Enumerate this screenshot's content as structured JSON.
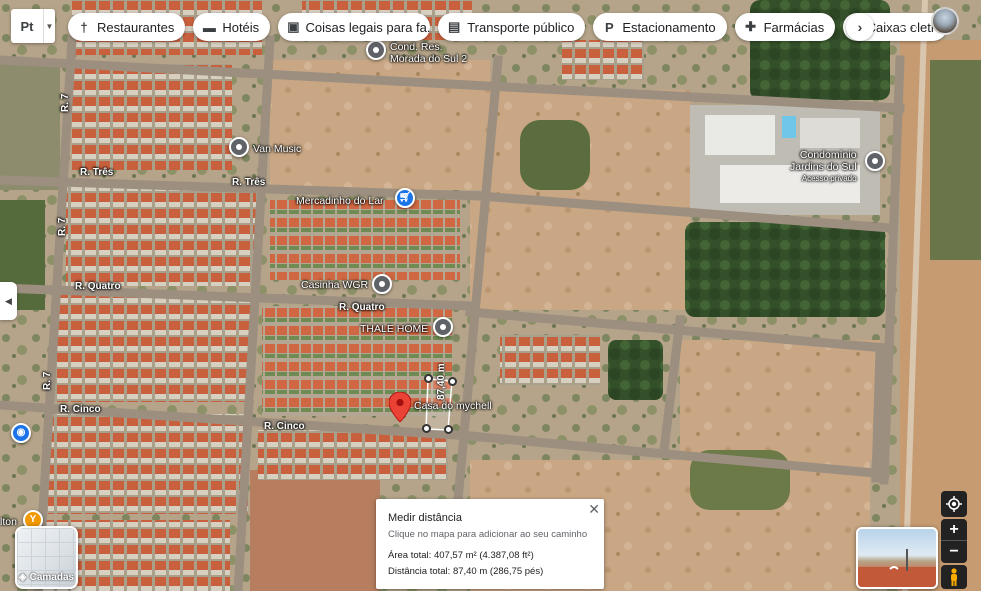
{
  "language_selector": {
    "label": "Pt"
  },
  "chips": [
    {
      "icon": "fork-knife-icon",
      "glyph": "†",
      "label": "Restaurantes"
    },
    {
      "icon": "bed-icon",
      "glyph": "▬",
      "label": "Hotéis"
    },
    {
      "icon": "camera-icon",
      "glyph": "▣",
      "label": "Coisas legais para fa..."
    },
    {
      "icon": "train-icon",
      "glyph": "▤",
      "label": "Transporte público"
    },
    {
      "icon": "parking-icon",
      "glyph": "P",
      "label": "Estacionamento"
    },
    {
      "icon": "pharmacy-icon",
      "glyph": "✚",
      "label": "Farmácias"
    },
    {
      "icon": "atm-icon",
      "glyph": "∷",
      "label": "Caixas eletrônicos"
    }
  ],
  "roads": {
    "r7_top": "R. 7",
    "r7_mid": "R. 7",
    "r7_bottom": "R. 7",
    "tres_left": "R. Três",
    "tres_right": "R. Três",
    "quatro_left": "R. Quatro",
    "quatro_right": "R. Quatro",
    "cinco_left": "R. Cinco",
    "cinco_right": "R. Cinco"
  },
  "places": {
    "cond_res_line1": "Cond. Res.",
    "cond_res_line2": "Morada do Sul 2",
    "van_music": "Van Music",
    "mercadinho": "Mercadinho do Lar",
    "casinha": "Casinha WGR",
    "thale_home": "THALE HOME",
    "casa_mychell": "Casa do mychell",
    "condominio_line1": "Condomínio",
    "condominio_line2": "Jardins do Sul",
    "acesso": "Acesso privado",
    "alton": "lton"
  },
  "measure_label": "87,40 m",
  "layers": {
    "label": "Camadas"
  },
  "measure_panel": {
    "title": "Medir distância",
    "hint": "Clique no mapa para adicionar ao seu caminho",
    "area": "Área total: 407,57 m² (4.387,08 ft²)",
    "distance": "Distância total: 87,40 m (286,75 pés)"
  },
  "colors": {
    "roof": "#c8603d",
    "dirt": "#c7a27d",
    "vegetation": "#3e5a2c",
    "road": "#9c8f80"
  }
}
